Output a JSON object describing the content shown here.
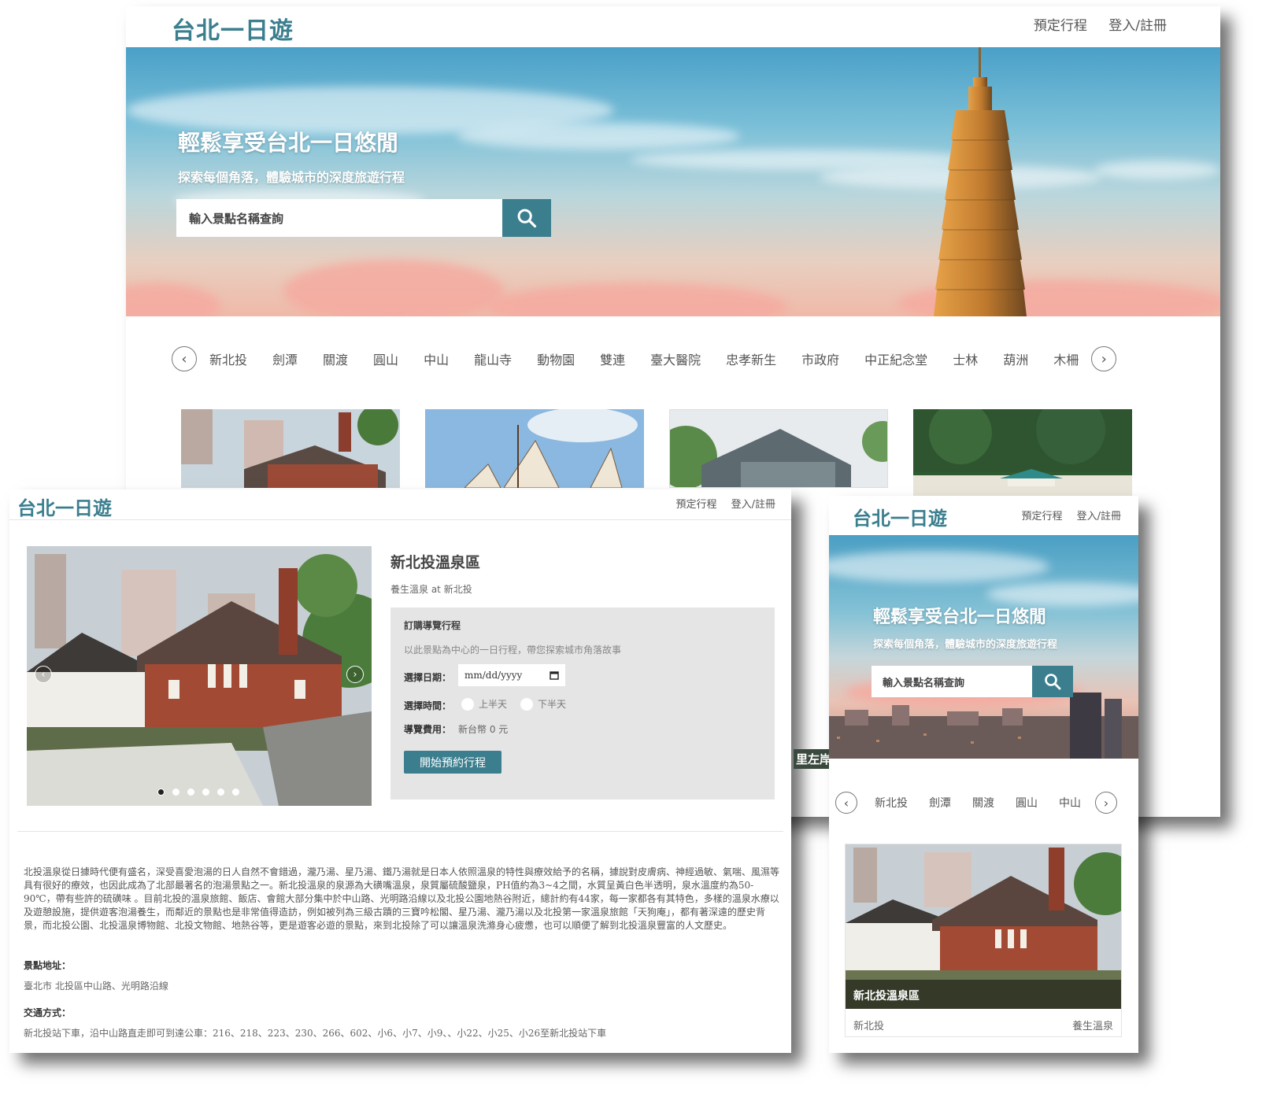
{
  "site": {
    "logo": "台北一日遊",
    "nav": [
      "預定行程",
      "登入/註冊"
    ]
  },
  "hero": {
    "title": "輕鬆享受台北一日悠閒",
    "subtitle": "探索每個角落，體驗城市的深度旅遊行程",
    "search_placeholder": "輸入景點名稱查詢"
  },
  "categories": [
    "新北投",
    "劍潭",
    "關渡",
    "圓山",
    "中山",
    "龍山寺",
    "動物園",
    "雙連",
    "臺大醫院",
    "忠孝新生",
    "市政府",
    "中正紀念堂",
    "士林",
    "葫洲",
    "木柵"
  ],
  "mobile_categories": [
    "新北投",
    "劍潭",
    "關渡",
    "圓山",
    "中山"
  ],
  "side_text": "里左岸",
  "detail": {
    "title": "新北投溫泉區",
    "subtitle": "養生溫泉 at 新北投",
    "booking": {
      "heading": "訂購導覽行程",
      "desc": "以此景點為中心的一日行程，帶您探索城市角落故事",
      "date_label": "選擇日期：",
      "date_value": "mm/dd/yyyy",
      "time_label": "選擇時間：",
      "time_options": [
        "上半天",
        "下半天"
      ],
      "fee_label": "導覽費用：",
      "fee_value": "新台幣 0 元",
      "button": "開始預約行程"
    },
    "description": "北投溫泉從日據時代便有盛名，深受喜愛泡湯的日人自然不會錯過，瀧乃湯、星乃湯、鐵乃湯就是日本人依照溫泉的特性與療效給予的名稱，據說對皮膚病、神經過敏、氣喘、風濕等具有很好的療效，也因此成為了北部最著名的泡湯景點之一。新北投溫泉的泉源為大磺嘴溫泉，泉質屬硫酸鹽泉，PH值約為3~4之間，水質呈黃白色半透明，泉水溫度約為50-90℃，帶有些許的硫磺味 。目前北投的溫泉旅館、飯店、會館大部分集中於中山路、光明路沿線以及北投公園地熱谷附近，總計約有44家，每一家都各有其特色，多樣的溫泉水療以及遊憩設施，提供遊客泡湯養生，而鄰近的景點也是非常值得造訪，例如被列為三級古蹟的三寶吟松閣、星乃湯、瀧乃湯以及北投第一家溫泉旅館「天狗庵」，都有著深遠的歷史背景，而北投公園、北投溫泉博物館、北投文物館、地熱谷等，更是遊客必遊的景點，來到北投除了可以讓溫泉洗滌身心疲憊，也可以順便了解到北投溫泉豐富的人文歷史。",
    "address_label": "景點地址：",
    "address": "臺北市 北投區中山路、光明路沿線",
    "transport_label": "交通方式：",
    "transport": "新北投站下車，沿中山路直走即可到達公車：216、218、223、230、266、602、小6、小7、小9、、小22、小25、小26至新北投站下車"
  },
  "mobile_card": {
    "title": "新北投溫泉區",
    "location": "新北投",
    "tag": "養生溫泉"
  },
  "colors": {
    "accent": "#3b7f8f",
    "booking_bg": "#e5e5e5"
  },
  "icons": [
    "search-icon",
    "chevron-left-icon",
    "chevron-right-icon"
  ]
}
